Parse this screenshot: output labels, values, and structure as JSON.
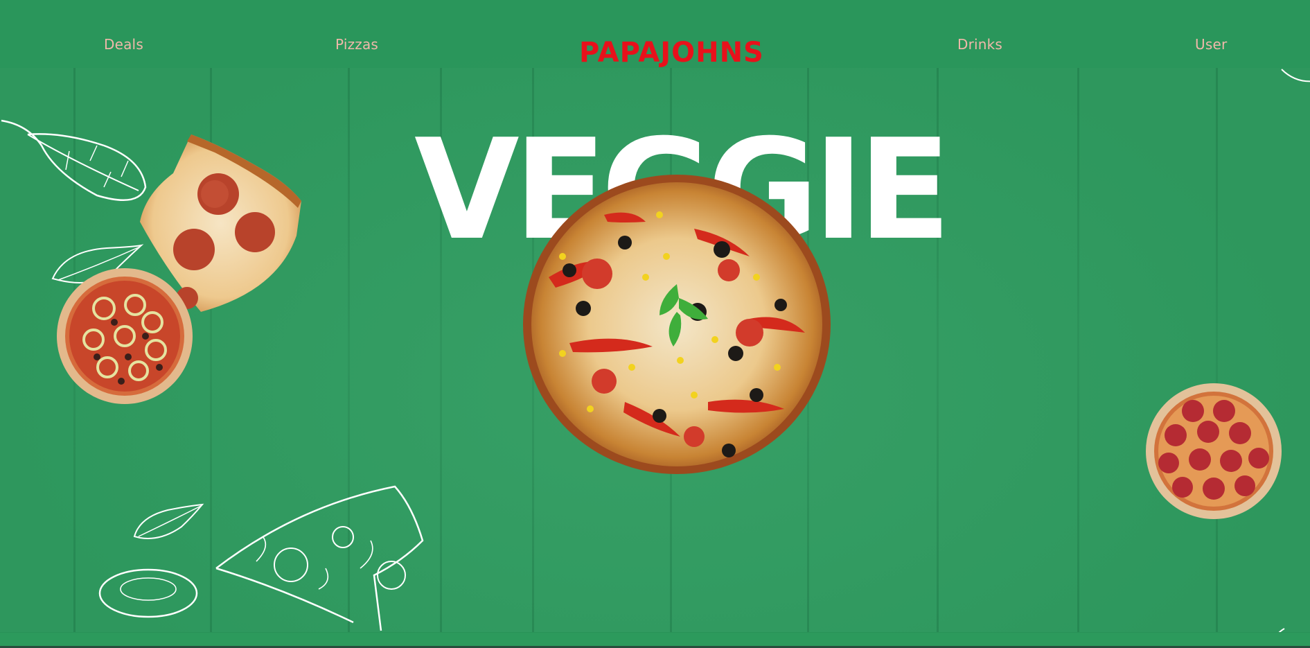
{
  "colors": {
    "background": "#2f9c60",
    "nav_text": "#f0b8aa",
    "logo": "#e8111b",
    "hero_text": "#ffffff"
  },
  "nav": {
    "deals": "Deals",
    "pizzas": "Pizzas",
    "logo": "PAPAJOHNS",
    "drinks": "Drinks",
    "user": "User"
  },
  "hero": {
    "title": "VEGGIE"
  },
  "images": {
    "main": "veggie-pizza-image",
    "slice": "pepperoni-slice-image",
    "small_left": "tomato-pepper-pizza-image",
    "small_right": "pepperoni-pizza-image",
    "sketches": [
      "basil-leaf-sketch-icon",
      "pizza-slice-sketch-icon",
      "olive-sketch-icon"
    ]
  }
}
